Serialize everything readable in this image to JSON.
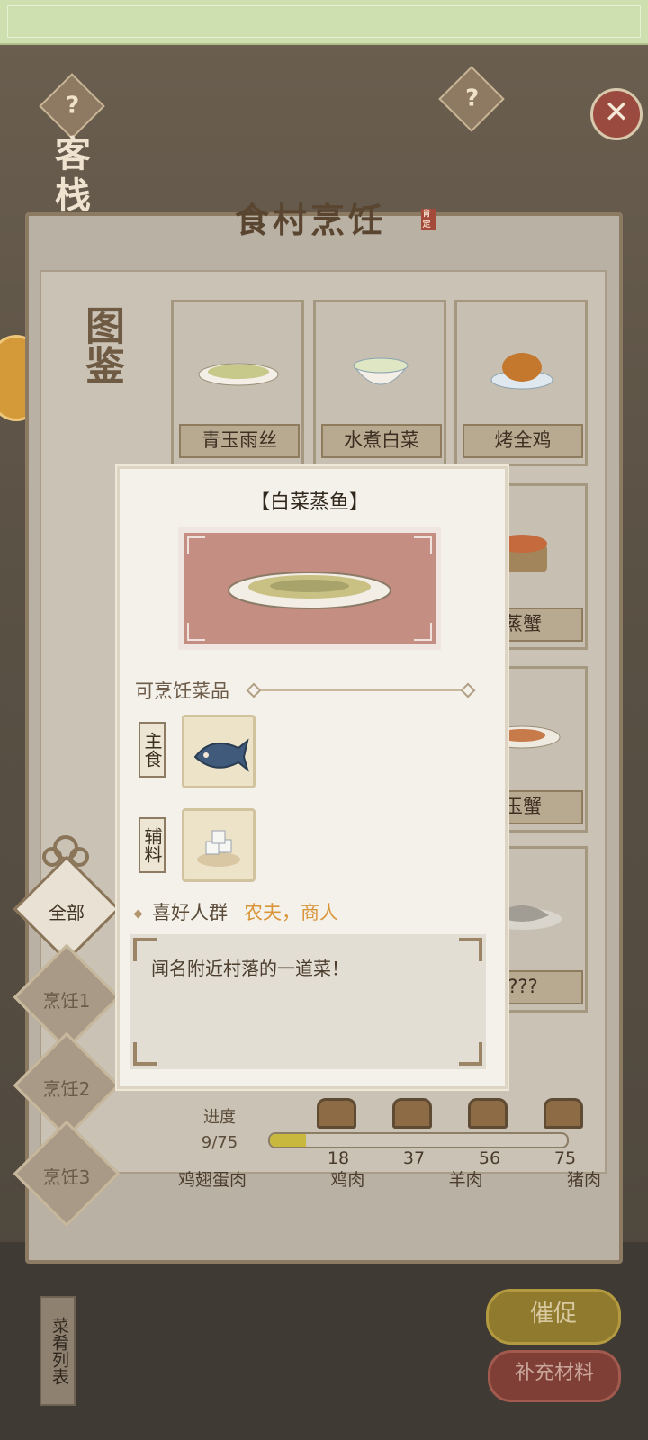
{
  "top_banner": {
    "text": ""
  },
  "scene": {
    "side_label": "客栈"
  },
  "panel": {
    "title": "食村烹饪",
    "seal": "肯定",
    "badge": "图鉴"
  },
  "grid": {
    "row1": [
      {
        "name": "青玉雨丝",
        "icon": "noodle-plate-icon"
      },
      {
        "name": "水煮白菜",
        "icon": "cabbage-bowl-icon"
      },
      {
        "name": "烤全鸡",
        "icon": "roast-chicken-icon"
      }
    ],
    "row2_right": {
      "name": "蒸蟹",
      "icon": "steamed-crab-icon"
    },
    "row3_right": {
      "name": "玉蟹",
      "icon": "crab-plate-icon"
    },
    "row4_right": {
      "name": "???",
      "icon": "locked-fish-icon"
    },
    "bottom_labels": [
      "鸡翅蛋肉",
      "鸡肉",
      "羊肉",
      "猪肉"
    ]
  },
  "filters": [
    {
      "label": "全部",
      "active": true
    },
    {
      "label": "烹饪1",
      "active": false
    },
    {
      "label": "烹饪2",
      "active": false
    },
    {
      "label": "烹饪3",
      "active": false
    }
  ],
  "progress": {
    "label": "进度",
    "value_text": "9/75",
    "current": 9,
    "total": 75,
    "milestones": [
      18,
      37,
      56,
      75
    ]
  },
  "buttons": {
    "urge": "催促",
    "supply": "补充材料",
    "dish_list": "菜肴列表"
  },
  "popup": {
    "title": "【白菜蒸鱼】",
    "section_label": "可烹饪菜品",
    "main_food_label": "主食",
    "main_food_icon": "fish-icon",
    "side_label": "辅料",
    "side_icon": "sugar-cubes-icon",
    "preference_label": "喜好人群",
    "preference_people": "农夫，商人",
    "description": "闻名附近村落的一道菜！"
  },
  "colors": {
    "accent_orange": "#d9953a",
    "progress_fill": "#c9b83e",
    "dish_bg": "#c58e82"
  }
}
